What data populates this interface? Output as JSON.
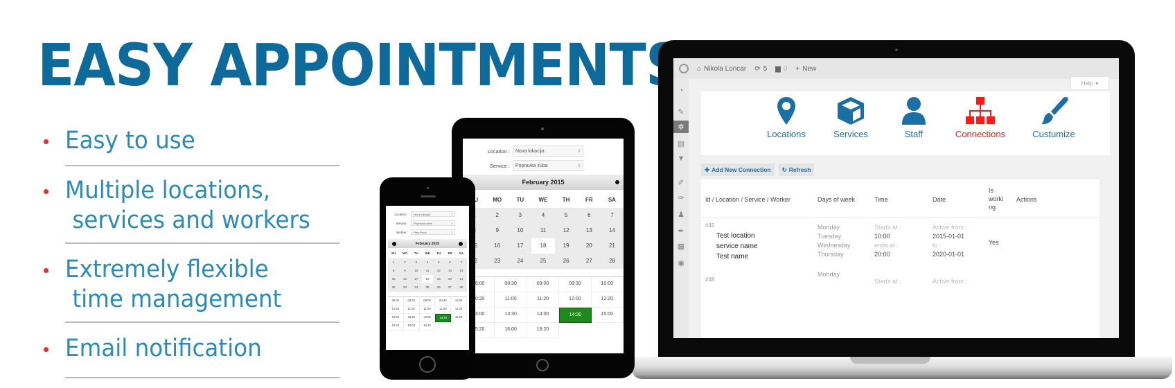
{
  "headline": "EASY APPOINTMENTS",
  "features": [
    {
      "lines": [
        "Easy to use"
      ]
    },
    {
      "lines": [
        "Multiple locations,",
        " services and workers"
      ]
    },
    {
      "lines": [
        "Extremely flexible",
        " time management"
      ]
    },
    {
      "lines": [
        "Email notification"
      ]
    }
  ],
  "colors": {
    "headline": "#0e6a9b",
    "feature_text": "#2a8ab9",
    "bullet": "#ee2a2a",
    "nav_blue": "#1a6fa4",
    "nav_active": "#ff1a1a",
    "slot_selected": "#1e8a1e"
  },
  "admin": {
    "adminbar": {
      "site_name": "Nikola Loncar",
      "updates_count": "5",
      "comments_count": "0",
      "new_label": "New"
    },
    "help_label": "Help",
    "sidebar_icons": [
      "dashboard-icon",
      "pin-icon",
      "settings-icon",
      "pages-icon",
      "comments-icon",
      "appearance-icon",
      "plugins-icon",
      "users-icon",
      "tools-icon",
      "settings-panel-icon",
      "circle-icon"
    ],
    "active_sidebar_index": 2,
    "nav": [
      {
        "label": "Locations",
        "icon": "map-marker-icon",
        "active": false
      },
      {
        "label": "Services",
        "icon": "cube-icon",
        "active": false
      },
      {
        "label": "Staff",
        "icon": "user-icon",
        "active": false
      },
      {
        "label": "Connections",
        "icon": "sitemap-icon",
        "active": true
      },
      {
        "label": "Custumize",
        "icon": "brush-icon",
        "active": false
      }
    ],
    "add_connection_label": "Add New Connection",
    "refresh_label": "Refresh",
    "table": {
      "headers": [
        "Id / Location / Service / Worker",
        "Days of week",
        "Time",
        "Date",
        "Is worki ng",
        "Actions"
      ],
      "rows": [
        {
          "id": "#45",
          "location": "Test location",
          "service": "service name",
          "worker": "Test name",
          "days": [
            "Monday",
            "Tuesday",
            "Wednesday",
            "Thursday"
          ],
          "starts_label": "Starts at :",
          "starts": "10:00",
          "ends_label": "ends at :",
          "ends": "20:00",
          "active_from_label": "Active from :",
          "active_from": "2015-01-01",
          "to_label": "to :",
          "to": "2020-01-01",
          "is_working": "Yes"
        },
        {
          "id": "#48",
          "days": [
            "Monday"
          ],
          "starts_label": "Starts at :",
          "active_from_label": "Active from :"
        }
      ]
    }
  },
  "booking": {
    "fields": [
      {
        "label": "Location :",
        "value": "Nova lokacija"
      },
      {
        "label": "Service :",
        "value": "Popravka zuba"
      },
      {
        "label": "Worker :",
        "value": "Pera Peric"
      }
    ],
    "month": "February 2015",
    "weekdays": [
      "SU",
      "MO",
      "TU",
      "WE",
      "TH",
      "FR",
      "SA"
    ],
    "days": [
      "1",
      "2",
      "3",
      "4",
      "5",
      "6",
      "7",
      "8",
      "9",
      "10",
      "11",
      "12",
      "13",
      "14",
      "15",
      "16",
      "17",
      "18",
      "19",
      "20",
      "21",
      "22",
      "23",
      "24",
      "25",
      "26",
      "27",
      "28"
    ],
    "selected_day": "18",
    "slots": [
      "08:00",
      "08:30",
      "09:00",
      "09:30",
      "10:00",
      "10:20",
      "11:00",
      "11:20",
      "12:00",
      "12:20",
      "13:00",
      "13:30",
      "14:00",
      "14:30",
      "15:00",
      "15:20",
      "16:00",
      "16:20"
    ],
    "selected_slot": "14:30"
  }
}
